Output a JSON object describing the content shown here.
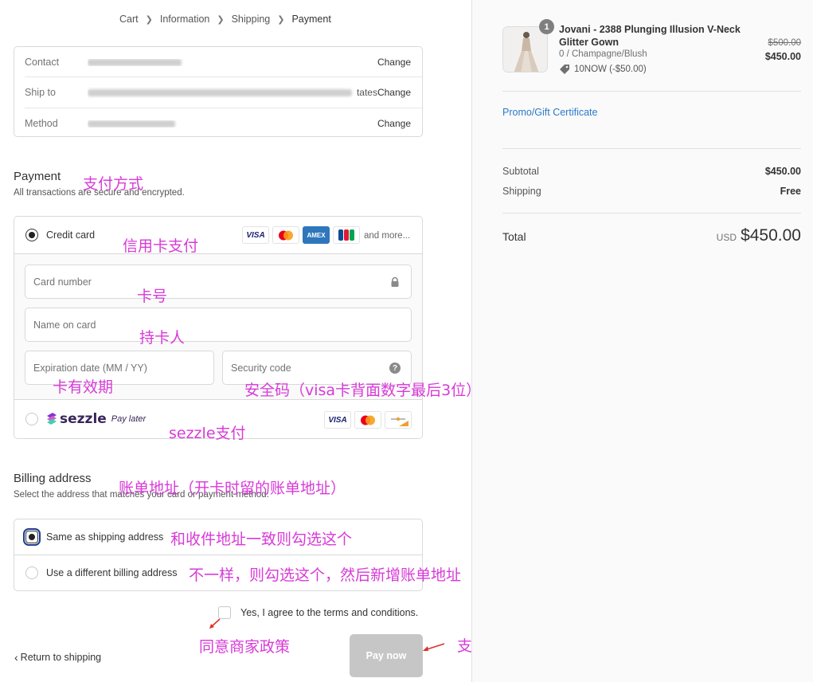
{
  "breadcrumb": [
    "Cart",
    "Information",
    "Shipping",
    "Payment"
  ],
  "review": {
    "contact_label": "Contact",
    "ship_label": "Ship to",
    "ship_tail": "tates",
    "method_label": "Method",
    "change_label": "Change"
  },
  "payment": {
    "title": "Payment",
    "subtitle": "All transactions are secure and encrypted.",
    "credit_card_label": "Credit card",
    "card_brands": [
      "VISA",
      "Mastercard",
      "AMEX",
      "JCB"
    ],
    "and_more": "and more...",
    "card_number_placeholder": "Card number",
    "name_placeholder": "Name on card",
    "expiry_placeholder": "Expiration date (MM / YY)",
    "security_placeholder": "Security code",
    "sezzle_brand": "sezzle",
    "sezzle_tag": "Pay later"
  },
  "billing": {
    "title": "Billing address",
    "subtitle": "Select the address that matches your card or payment method.",
    "same_label": "Same as shipping address",
    "different_label": "Use a different billing address"
  },
  "terms_label": "Yes, I agree to the terms and conditions.",
  "return_label": "Return to shipping",
  "pay_button": "Pay now",
  "annotations": {
    "payment_method": "支付方式",
    "credit_card": "信用卡支付",
    "card_number": "卡号",
    "cardholder": "持卡人",
    "expiry": "卡有效期",
    "security": "安全码（visa卡背面数字最后3位）",
    "sezzle": "sezzle支付",
    "billing": "账单地址（开卡时留的账单地址）",
    "same": "和收件地址一致则勾选这个",
    "different": "不一样，则勾选这个，然后新增账单地址",
    "agree": "同意商家政策",
    "pay": "支付"
  },
  "order": {
    "quantity": "1",
    "product_name": "Jovani - 2388 Plunging Illusion V-Neck Glitter Gown",
    "variant": "0 / Champagne/Blush",
    "discount": "10NOW (-$50.00)",
    "compare_price": "$500.00",
    "price": "$450.00",
    "promo_link": "Promo/Gift Certificate",
    "subtotal_label": "Subtotal",
    "subtotal_value": "$450.00",
    "shipping_label": "Shipping",
    "shipping_value": "Free",
    "total_label": "Total",
    "currency": "USD",
    "total_value": "$450.00"
  },
  "colors": {
    "annotation": "#d83ad8",
    "link": "#2c7ac9",
    "pay_button_disabled": "#c6c6c6",
    "arrow": "#e0302a"
  }
}
